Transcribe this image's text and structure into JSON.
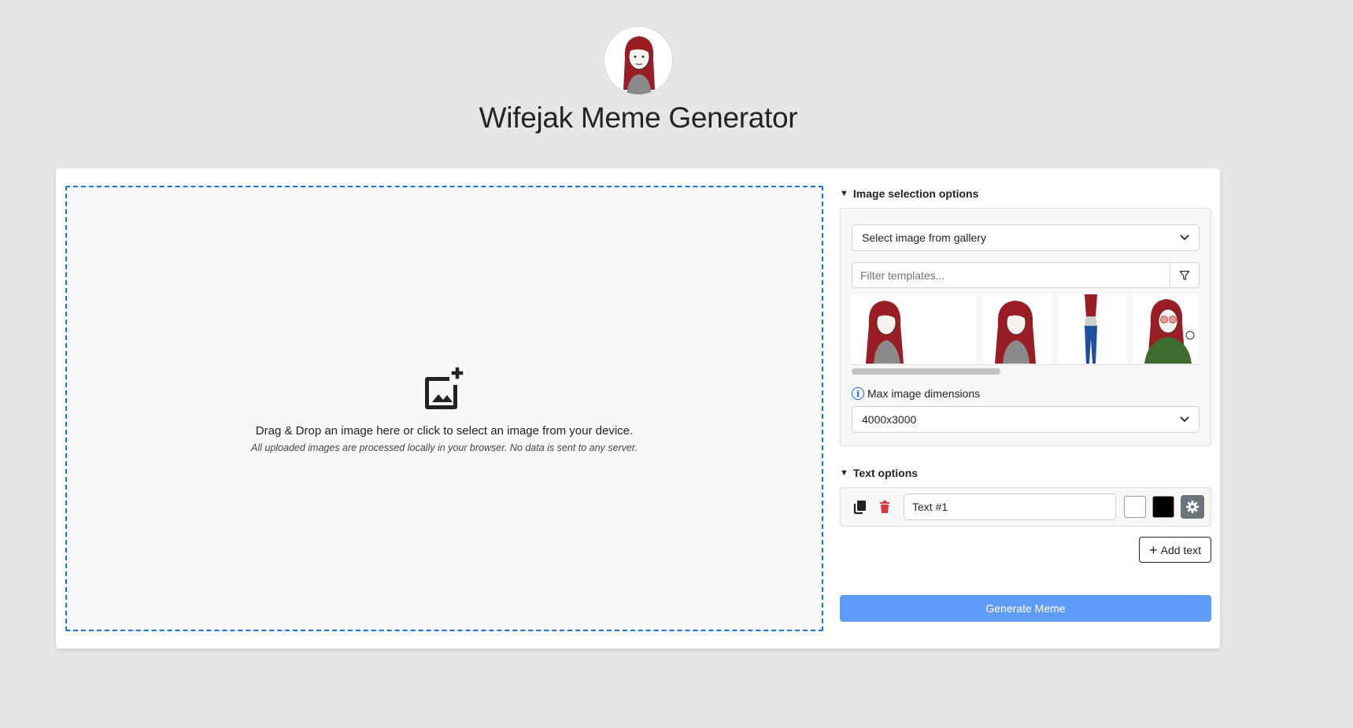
{
  "header": {
    "title": "Wifejak Meme Generator"
  },
  "dropzone": {
    "instruction": "Drag & Drop an image here or click to select an image from your device.",
    "privacy_note": "All uploaded images are processed locally in your browser. No data is sent to any server."
  },
  "image_options": {
    "section_label": "Image selection options",
    "gallery_select": "Select image from gallery",
    "filter_placeholder": "Filter templates...",
    "thumbnails": [
      "wifejak-thumb-1",
      "wifejak-thumb-2",
      "wifejak-thumb-3",
      "wifejak-thumb-4"
    ],
    "max_dim_label": "Max image dimensions",
    "max_dim_value": "4000x3000"
  },
  "text_options": {
    "section_label": "Text options",
    "text_value": "Text #1",
    "fill_color": "#ffffff",
    "stroke_color": "#000000",
    "add_text_label": "Add text"
  },
  "actions": {
    "generate_label": "Generate Meme"
  },
  "colors": {
    "accent": "#1a6fe0",
    "generate_bg": "#5e9cf7",
    "delete": "#dc3545",
    "gear_bg": "#6c757d"
  }
}
